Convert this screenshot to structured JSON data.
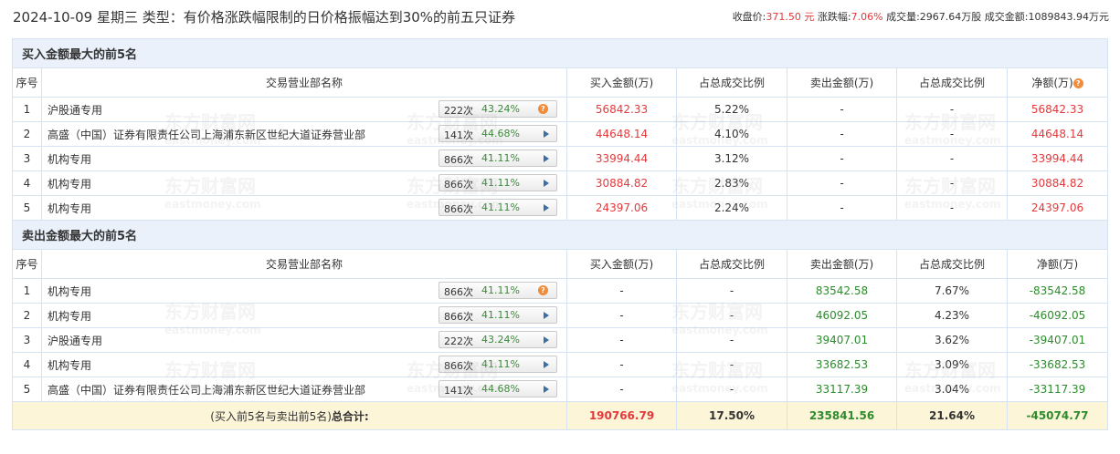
{
  "header": {
    "title": "2024-10-09 星期三 类型：有价格涨跌幅限制的日价格振幅达到30%的前五只证券",
    "close_label": "收盘价:",
    "close_value": "371.50 元",
    "change_label": "涨跌幅:",
    "change_value": "7.06%",
    "volume_label": "成交量:",
    "volume_value": "2967.64万股",
    "amount_label": "成交金额:",
    "amount_value": "1089843.94万元"
  },
  "columns": {
    "seq": "序号",
    "dept": "交易营业部名称",
    "buy": "买入金额(万)",
    "buy_ratio": "占总成交比例",
    "sell": "卖出金额(万)",
    "sell_ratio": "占总成交比例",
    "net": "净额(万)",
    "help": "?"
  },
  "buy_section": {
    "title": "买入金额最大的前5名",
    "rows": [
      {
        "seq": "1",
        "name": "沪股通专用",
        "count": "222次",
        "rate": "43.24%",
        "buy": "56842.33",
        "buy_ratio": "5.22%",
        "sell": "-",
        "sell_ratio": "-",
        "net": "56842.33",
        "has_help": true
      },
      {
        "seq": "2",
        "name": "高盛（中国）证券有限责任公司上海浦东新区世纪大道证券营业部",
        "count": "141次",
        "rate": "44.68%",
        "buy": "44648.14",
        "buy_ratio": "4.10%",
        "sell": "-",
        "sell_ratio": "-",
        "net": "44648.14",
        "has_help": false
      },
      {
        "seq": "3",
        "name": "机构专用",
        "count": "866次",
        "rate": "41.11%",
        "buy": "33994.44",
        "buy_ratio": "3.12%",
        "sell": "-",
        "sell_ratio": "-",
        "net": "33994.44",
        "has_help": false
      },
      {
        "seq": "4",
        "name": "机构专用",
        "count": "866次",
        "rate": "41.11%",
        "buy": "30884.82",
        "buy_ratio": "2.83%",
        "sell": "-",
        "sell_ratio": "-",
        "net": "30884.82",
        "has_help": false
      },
      {
        "seq": "5",
        "name": "机构专用",
        "count": "866次",
        "rate": "41.11%",
        "buy": "24397.06",
        "buy_ratio": "2.24%",
        "sell": "-",
        "sell_ratio": "-",
        "net": "24397.06",
        "has_help": false
      }
    ]
  },
  "sell_section": {
    "title": "卖出金额最大的前5名",
    "rows": [
      {
        "seq": "1",
        "name": "机构专用",
        "count": "866次",
        "rate": "41.11%",
        "buy": "-",
        "buy_ratio": "-",
        "sell": "83542.58",
        "sell_ratio": "7.67%",
        "net": "-83542.58",
        "has_help": true
      },
      {
        "seq": "2",
        "name": "机构专用",
        "count": "866次",
        "rate": "41.11%",
        "buy": "-",
        "buy_ratio": "-",
        "sell": "46092.05",
        "sell_ratio": "4.23%",
        "net": "-46092.05",
        "has_help": false
      },
      {
        "seq": "3",
        "name": "沪股通专用",
        "count": "222次",
        "rate": "43.24%",
        "buy": "-",
        "buy_ratio": "-",
        "sell": "39407.01",
        "sell_ratio": "3.62%",
        "net": "-39407.01",
        "has_help": false
      },
      {
        "seq": "4",
        "name": "机构专用",
        "count": "866次",
        "rate": "41.11%",
        "buy": "-",
        "buy_ratio": "-",
        "sell": "33682.53",
        "sell_ratio": "3.09%",
        "net": "-33682.53",
        "has_help": false
      },
      {
        "seq": "5",
        "name": "高盛（中国）证券有限责任公司上海浦东新区世纪大道证券营业部",
        "count": "141次",
        "rate": "44.68%",
        "buy": "-",
        "buy_ratio": "-",
        "sell": "33117.39",
        "sell_ratio": "3.04%",
        "net": "-33117.39",
        "has_help": false
      }
    ]
  },
  "total": {
    "label_prefix": "(买入前5名与卖出前5名)",
    "label_bold": "总合计:",
    "buy": "190766.79",
    "buy_ratio": "17.50%",
    "sell": "235841.56",
    "sell_ratio": "21.64%",
    "net": "-45074.77"
  },
  "watermark": {
    "cn": "东方财富网",
    "en": "eastmoney.com"
  },
  "colors": {
    "red": "#e4393c",
    "green": "#2e8b2e",
    "header_bg": "#eaf1fb",
    "total_bg": "#fdf5d8",
    "border": "#d6e3f2"
  }
}
